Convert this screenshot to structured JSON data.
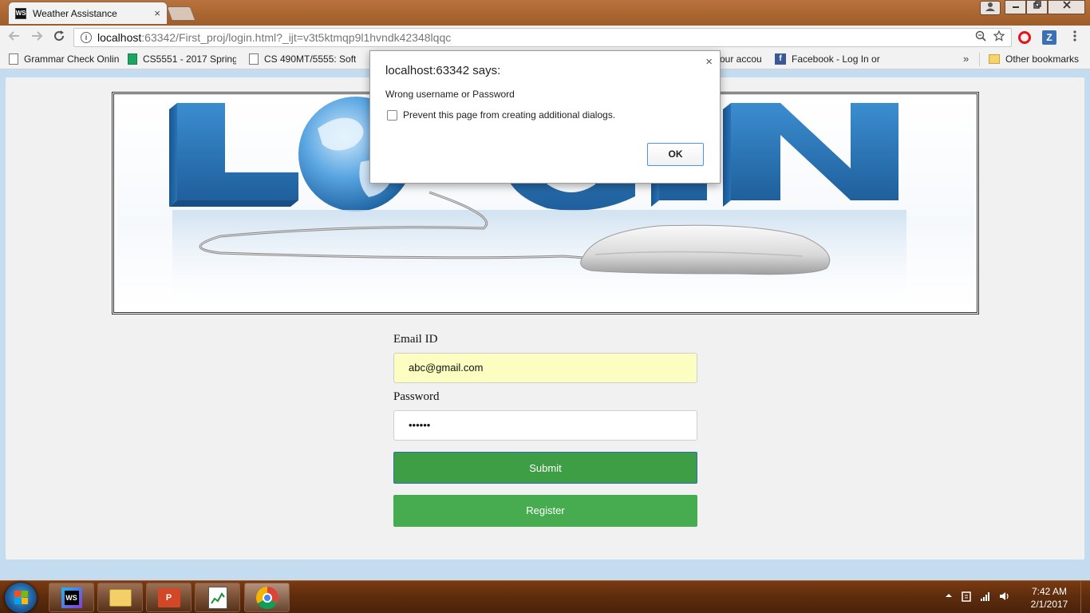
{
  "browser": {
    "tab_title": "Weather Assistance",
    "tab_favicon": "WS",
    "tab_close": "×",
    "url_host": "localhost",
    "url_path": ":63342/First_proj/login.html?_ijt=v3t5ktmqp9l1hvndk42348lqqc",
    "menu_icon": "⋮"
  },
  "bookmarks": {
    "items": [
      {
        "label": "Grammar Check Onlin"
      },
      {
        "label": "CS5551 - 2017 Spring"
      },
      {
        "label": "CS 490MT/5555: Softv"
      },
      {
        "label": "our accou"
      },
      {
        "label": "Facebook - Log In or"
      }
    ],
    "overflow": "»",
    "other": "Other bookmarks"
  },
  "dialog": {
    "title": "localhost:63342 says:",
    "message": "Wrong username or Password",
    "checkbox_label": "Prevent this page from creating additional dialogs.",
    "ok_label": "OK",
    "close": "×"
  },
  "form": {
    "email_label": "Email ID",
    "email_value": "abc@gmail.com",
    "password_label": "Password",
    "password_value": "••••••",
    "submit_label": "Submit",
    "register_label": "Register"
  },
  "banner": {
    "alt_text": "LOGIN"
  },
  "taskbar": {
    "time": "7:42 AM",
    "date": "2/1/2017",
    "ws_label": "WS",
    "ppt_label": "P"
  },
  "colors": {
    "submit_bg": "#3e9e45",
    "register_bg": "#46ac4f",
    "autofill_bg": "#fbfdc1",
    "login_blue": "#2f7ec1"
  }
}
